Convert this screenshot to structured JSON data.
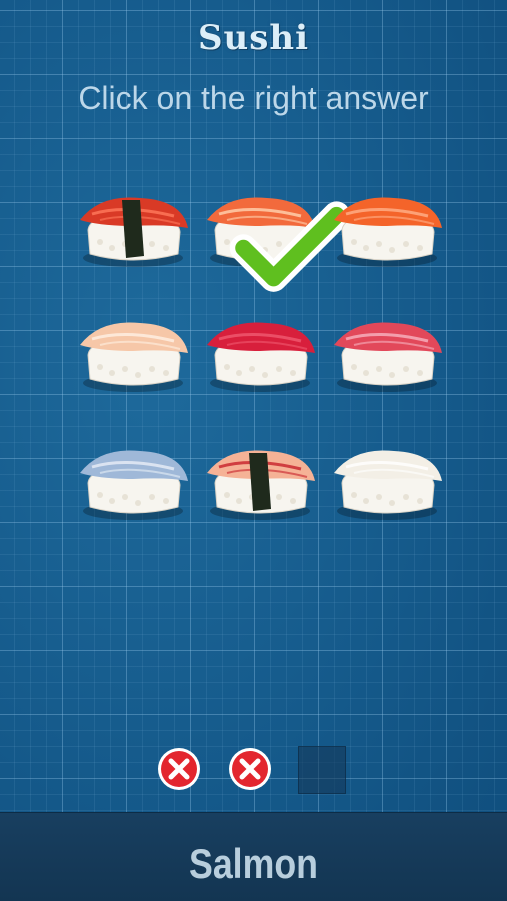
{
  "game": {
    "title": "Sushi",
    "instruction": "Click on the right answer",
    "target_answer": "Salmon"
  },
  "options": [
    {
      "icon": "crab-stick-nigiri-icon",
      "topping": "#d93a26",
      "stripe": "#ff7a5c",
      "nori": true,
      "selected": false
    },
    {
      "icon": "shrimp-nigiri-icon",
      "topping": "#f26a3c",
      "stripe": "#ffd3b0",
      "nori": false,
      "selected": true
    },
    {
      "icon": "salmon-nigiri-icon",
      "topping": "#f4642a",
      "stripe": "#ffb08a",
      "nori": false,
      "selected": false
    },
    {
      "icon": "white-fish-nigiri-icon",
      "topping": "#f6c7a8",
      "stripe": "#fff0e3",
      "nori": false,
      "selected": false
    },
    {
      "icon": "tuna-nigiri-icon",
      "topping": "#d81f3c",
      "stripe": "#f05a70",
      "nori": false,
      "selected": false
    },
    {
      "icon": "fatty-tuna-nigiri-icon",
      "topping": "#e2485a",
      "stripe": "#f7b4c0",
      "nori": false,
      "selected": false
    },
    {
      "icon": "mackerel-nigiri-icon",
      "topping": "#9fb8d8",
      "stripe": "#e8eef7",
      "nori": false,
      "selected": false
    },
    {
      "icon": "yellowtail-nigiri-icon",
      "topping": "#f5b296",
      "stripe": "#c7202a",
      "nori": true,
      "selected": false
    },
    {
      "icon": "squid-nigiri-icon",
      "topping": "#f3efe6",
      "stripe": "#ffffff",
      "nori": false,
      "selected": false
    }
  ],
  "lives": [
    "wrong",
    "wrong",
    "empty"
  ],
  "colors": {
    "background": "#165a8c",
    "check": "#5fbf1f",
    "wrong_mark": "#e3262e"
  }
}
